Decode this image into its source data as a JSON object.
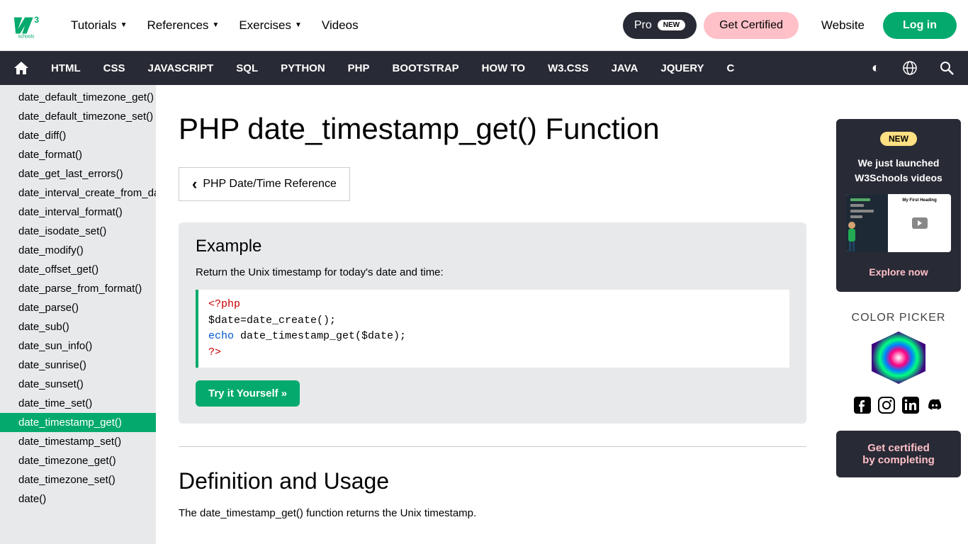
{
  "topnav": {
    "tutorials": "Tutorials",
    "references": "References",
    "exercises": "Exercises",
    "videos": "Videos",
    "pro": "Pro",
    "pro_badge": "NEW",
    "get_certified": "Get Certified",
    "website": "Website",
    "login": "Log in"
  },
  "secondnav": [
    "HTML",
    "CSS",
    "JAVASCRIPT",
    "SQL",
    "PYTHON",
    "PHP",
    "BOOTSTRAP",
    "HOW TO",
    "W3.CSS",
    "JAVA",
    "JQUERY",
    "C"
  ],
  "sidebar": {
    "items": [
      "date_default_timezone_get()",
      "date_default_timezone_set()",
      "date_diff()",
      "date_format()",
      "date_get_last_errors()",
      "date_interval_create_from_dat",
      "date_interval_format()",
      "date_isodate_set()",
      "date_modify()",
      "date_offset_get()",
      "date_parse_from_format()",
      "date_parse()",
      "date_sub()",
      "date_sun_info()",
      "date_sunrise()",
      "date_sunset()",
      "date_time_set()",
      "date_timestamp_get()",
      "date_timestamp_set()",
      "date_timezone_get()",
      "date_timezone_set()",
      "date()"
    ],
    "active_index": 17
  },
  "page": {
    "title": "PHP date_timestamp_get() Function",
    "back_link": "PHP Date/Time Reference",
    "example_heading": "Example",
    "example_desc": "Return the Unix timestamp for today's date and time:",
    "code": {
      "l1": "<?php",
      "l2a": "$date=date_create();",
      "l3a": "echo",
      "l3b": " date_timestamp_get($date);",
      "l4": "?>"
    },
    "try_it": "Try it Yourself »",
    "def_heading": "Definition and Usage",
    "def_text": "The date_timestamp_get() function returns the Unix timestamp."
  },
  "right": {
    "promo_new": "NEW",
    "promo_text1": "We just launched",
    "promo_text2": "W3Schools videos",
    "promo_video_title": "My First Heading",
    "explore": "Explore now",
    "cp_title": "COLOR PICKER",
    "cert1": "Get certified",
    "cert2": "by completing"
  }
}
